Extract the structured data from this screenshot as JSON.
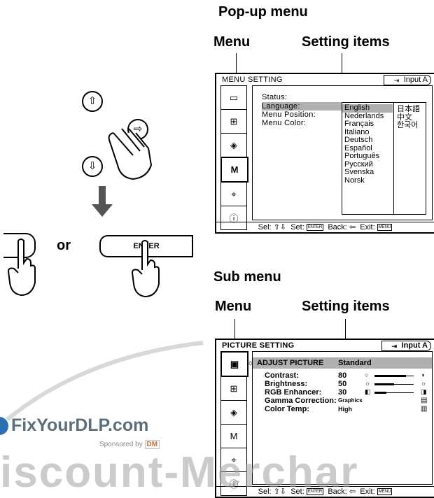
{
  "popup": {
    "heading": "Pop-up menu",
    "menu_label": "Menu",
    "items_label": "Setting items",
    "osd_title": "MENU SETTING",
    "input": "Input A",
    "items": [
      "Status:",
      "Language:",
      "Menu Position:",
      "Menu Color:"
    ],
    "languages_col1": [
      "English",
      "Nederlands",
      "Français",
      "Italiano",
      "Deutsch",
      "Español",
      "Português",
      "Русский",
      "Svenska",
      "Norsk"
    ],
    "languages_col2": [
      "日本語",
      "中文",
      "한국어"
    ],
    "bottom": {
      "sel": "Sel:",
      "sel_icon": "⇧⇩",
      "set": "Set:",
      "enter": "ENTER",
      "back": "Back:",
      "back_icon": "⇦",
      "exit": "Exit:",
      "menu": "MENU"
    }
  },
  "sub": {
    "heading": "Sub menu",
    "menu_label": "Menu",
    "items_label": "Setting items",
    "osd_title": "PICTURE SETTING",
    "input": "Input A",
    "header_item": "ADJUST PICTURE",
    "header_value": "Standard",
    "rows": [
      {
        "label": "Contrast:",
        "value": "80",
        "level": 0.8
      },
      {
        "label": "Brightness:",
        "value": "50",
        "level": 0.5
      },
      {
        "label": "RGB Enhancer:",
        "value": "30",
        "level": 0.3
      },
      {
        "label": "Gamma Correction:",
        "value": "Graphics"
      },
      {
        "label": "Color Temp:",
        "value": "High"
      }
    ],
    "bottom": {
      "sel": "Sel:",
      "sel_icon": "⇧⇩",
      "set": "Set:",
      "enter": "ENTER",
      "back": "Back:",
      "back_icon": "⇦",
      "exit": "Exit:",
      "menu": "MENU"
    }
  },
  "controls": {
    "or_label": "or",
    "enter_key": "ENTER"
  },
  "watermark": {
    "brand": "FixYourDLP.com",
    "sponsored": "Sponsored by",
    "sponsor_logo": "DM",
    "bottom_text": "iscount-Merchar"
  }
}
